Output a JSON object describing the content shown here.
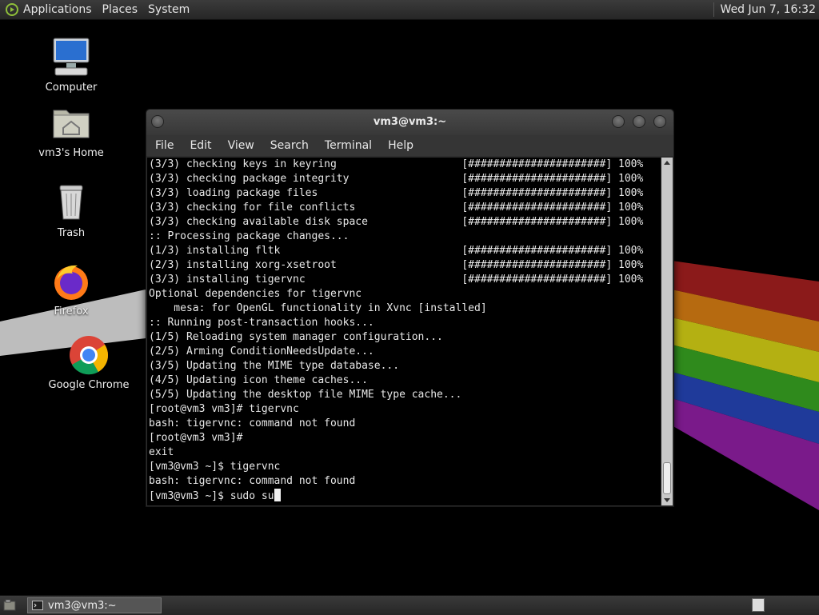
{
  "top_panel": {
    "menus": [
      "Applications",
      "Places",
      "System"
    ],
    "clock": "Wed Jun  7, 16:32"
  },
  "desktop_icons": [
    {
      "label": "Computer",
      "icon": "computer-icon"
    },
    {
      "label": "vm3's Home",
      "icon": "home-folder-icon"
    },
    {
      "label": "Trash",
      "icon": "trash-icon"
    },
    {
      "label": "Firefox",
      "icon": "firefox-icon"
    },
    {
      "label": "Google Chrome",
      "icon": "chrome-icon"
    }
  ],
  "terminal": {
    "title": "vm3@vm3:~",
    "menus": [
      "File",
      "Edit",
      "View",
      "Search",
      "Terminal",
      "Help"
    ],
    "lines": [
      "(3/3) checking keys in keyring                    [######################] 100%",
      "(3/3) checking package integrity                  [######################] 100%",
      "(3/3) loading package files                       [######################] 100%",
      "(3/3) checking for file conflicts                 [######################] 100%",
      "(3/3) checking available disk space               [######################] 100%",
      ":: Processing package changes...",
      "(1/3) installing fltk                             [######################] 100%",
      "(2/3) installing xorg-xsetroot                    [######################] 100%",
      "(3/3) installing tigervnc                         [######################] 100%",
      "Optional dependencies for tigervnc",
      "    mesa: for OpenGL functionality in Xvnc [installed]",
      ":: Running post-transaction hooks...",
      "(1/5) Reloading system manager configuration...",
      "(2/5) Arming ConditionNeedsUpdate...",
      "(3/5) Updating the MIME type database...",
      "(4/5) Updating icon theme caches...",
      "(5/5) Updating the desktop file MIME type cache...",
      "[root@vm3 vm3]# tigervnc",
      "bash: tigervnc: command not found",
      "[root@vm3 vm3]#",
      "exit",
      "[vm3@vm3 ~]$ tigervnc",
      "bash: tigervnc: command not found"
    ],
    "prompt": "[vm3@vm3 ~]$ sudo su"
  },
  "taskbar": {
    "window_label": "vm3@vm3:~"
  },
  "colors": {
    "terminal_bg": "#000000",
    "terminal_fg": "#e8e8e8",
    "panel_bg": "#2e2e2e"
  }
}
